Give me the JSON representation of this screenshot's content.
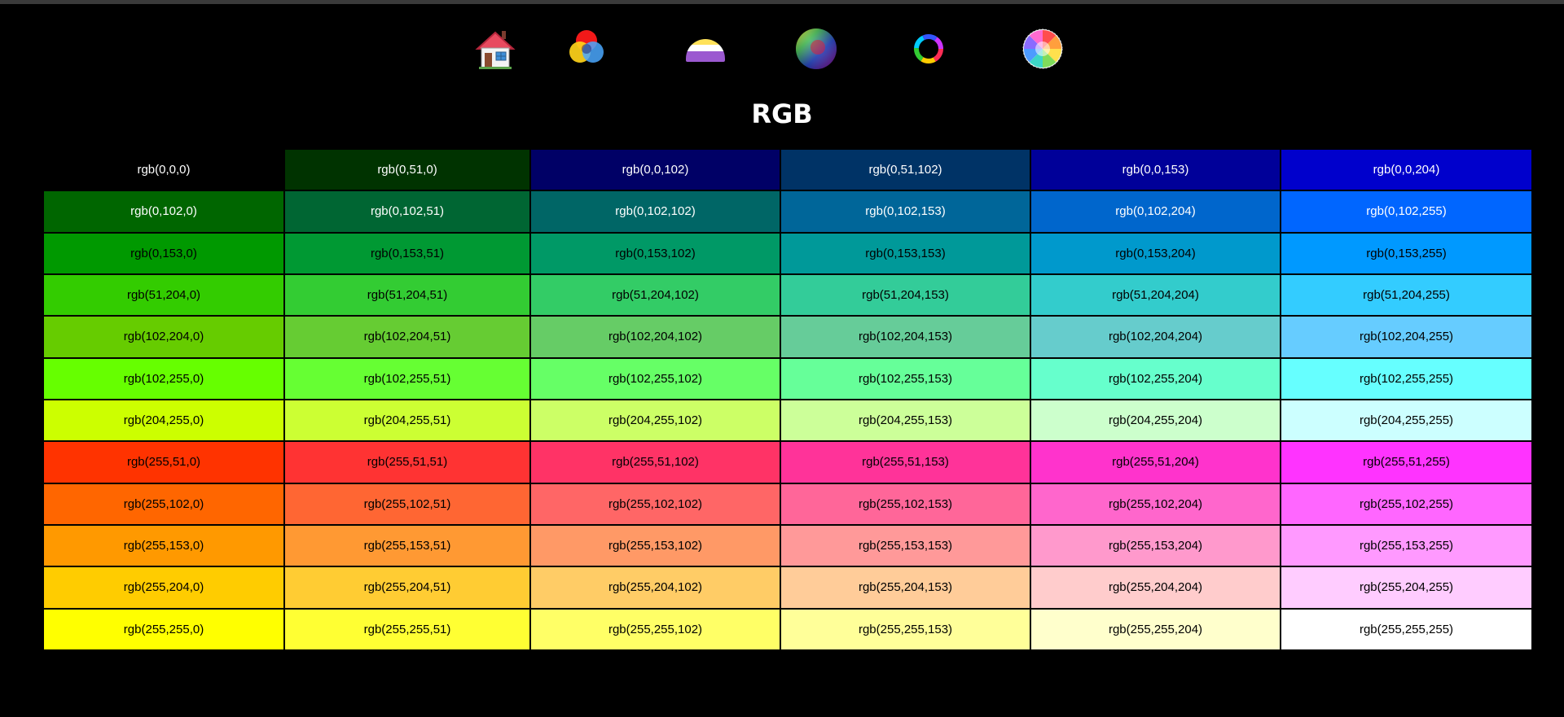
{
  "nav": {
    "items": [
      {
        "name": "home-icon"
      },
      {
        "name": "rgb-circles-icon"
      },
      {
        "name": "striped-semicircle-icon"
      },
      {
        "name": "color-sphere-icon"
      },
      {
        "name": "color-ring-icon"
      },
      {
        "name": "color-wheel-icon"
      }
    ]
  },
  "page": {
    "title": "RGB"
  },
  "grid": {
    "rows": [
      [
        "rgb(0,0,0)",
        "rgb(0,51,0)",
        "rgb(0,0,102)",
        "rgb(0,51,102)",
        "rgb(0,0,153)",
        "rgb(0,0,204)"
      ],
      [
        "rgb(0,102,0)",
        "rgb(0,102,51)",
        "rgb(0,102,102)",
        "rgb(0,102,153)",
        "rgb(0,102,204)",
        "rgb(0,102,255)"
      ],
      [
        "rgb(0,153,0)",
        "rgb(0,153,51)",
        "rgb(0,153,102)",
        "rgb(0,153,153)",
        "rgb(0,153,204)",
        "rgb(0,153,255)"
      ],
      [
        "rgb(51,204,0)",
        "rgb(51,204,51)",
        "rgb(51,204,102)",
        "rgb(51,204,153)",
        "rgb(51,204,204)",
        "rgb(51,204,255)"
      ],
      [
        "rgb(102,204,0)",
        "rgb(102,204,51)",
        "rgb(102,204,102)",
        "rgb(102,204,153)",
        "rgb(102,204,204)",
        "rgb(102,204,255)"
      ],
      [
        "rgb(102,255,0)",
        "rgb(102,255,51)",
        "rgb(102,255,102)",
        "rgb(102,255,153)",
        "rgb(102,255,204)",
        "rgb(102,255,255)"
      ],
      [
        "rgb(204,255,0)",
        "rgb(204,255,51)",
        "rgb(204,255,102)",
        "rgb(204,255,153)",
        "rgb(204,255,204)",
        "rgb(204,255,255)"
      ],
      [
        "rgb(255,51,0)",
        "rgb(255,51,51)",
        "rgb(255,51,102)",
        "rgb(255,51,153)",
        "rgb(255,51,204)",
        "rgb(255,51,255)"
      ],
      [
        "rgb(255,102,0)",
        "rgb(255,102,51)",
        "rgb(255,102,102)",
        "rgb(255,102,153)",
        "rgb(255,102,204)",
        "rgb(255,102,255)"
      ],
      [
        "rgb(255,153,0)",
        "rgb(255,153,51)",
        "rgb(255,153,102)",
        "rgb(255,153,153)",
        "rgb(255,153,204)",
        "rgb(255,153,255)"
      ],
      [
        "rgb(255,204,0)",
        "rgb(255,204,51)",
        "rgb(255,204,102)",
        "rgb(255,204,153)",
        "rgb(255,204,204)",
        "rgb(255,204,255)"
      ],
      [
        "rgb(255,255,0)",
        "rgb(255,255,51)",
        "rgb(255,255,102)",
        "rgb(255,255,153)",
        "rgb(255,255,204)",
        "rgb(255,255,255)"
      ]
    ],
    "dark_rows": [
      0,
      1
    ]
  }
}
